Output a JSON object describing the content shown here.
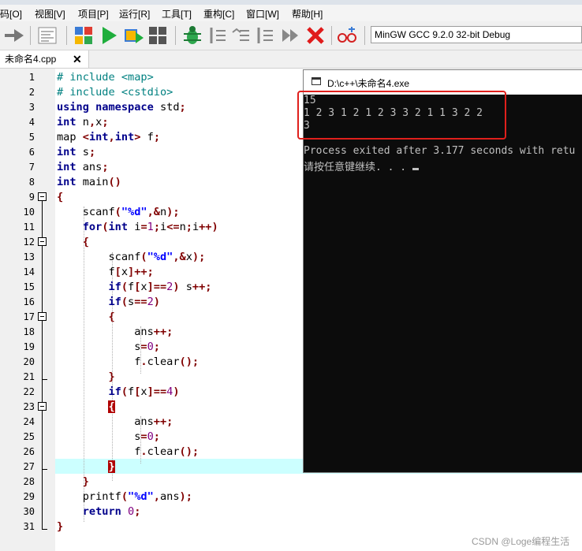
{
  "menu": [
    "码[O]",
    "视图[V]",
    "项目[P]",
    "运行[R]",
    "工具[T]",
    "重构[C]",
    "窗口[W]",
    "帮助[H]"
  ],
  "compiler": "MinGW GCC 9.2.0 32-bit Debug",
  "tab": {
    "title": "未命名4.cpp",
    "close": "✕"
  },
  "line_numbers": [
    "1",
    "2",
    "3",
    "4",
    "5",
    "6",
    "7",
    "8",
    "9",
    "10",
    "11",
    "12",
    "13",
    "14",
    "15",
    "16",
    "17",
    "18",
    "19",
    "20",
    "21",
    "22",
    "23",
    "24",
    "25",
    "26",
    "27",
    "28",
    "29",
    "30",
    "31"
  ],
  "console": {
    "title": "D:\\c++\\未命名4.exe",
    "lines": [
      "15",
      "1 2 3 1 2 1 2 3 3 2 1 1 3 2 2",
      "3",
      "",
      "Process exited after 3.177 seconds with retu",
      "请按任意键继续. . ."
    ]
  },
  "watermark": "CSDN @Loge编程生活"
}
